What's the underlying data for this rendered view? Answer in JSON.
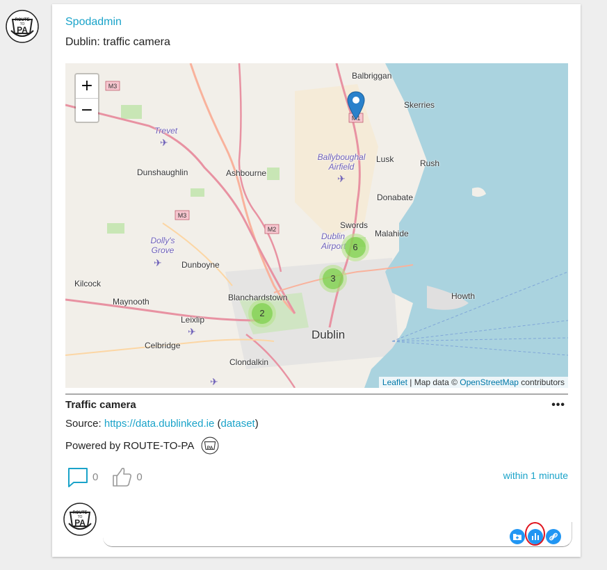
{
  "post": {
    "author": "Spodadmin",
    "text": "Dublin: traffic camera"
  },
  "avatar": {
    "logo_text_top": "ROUTE",
    "logo_text_mid": "TO",
    "logo_text_bottom": "PA"
  },
  "map": {
    "zoom_in": "+",
    "zoom_out": "−",
    "attribution": {
      "leaflet": "Leaflet",
      "sep": " | Map data © ",
      "osm": "OpenStreetMap",
      "contributors": " contributors"
    },
    "clusters": [
      "6",
      "3",
      "2"
    ],
    "places": [
      "Balbriggan",
      "Skerries",
      "Trevet",
      "Lusk",
      "Rush",
      "Ballyboughal Airfield",
      "Dunshaughlin",
      "Ashbourne",
      "Donabate",
      "Swords",
      "Malahide",
      "Dublin Airport",
      "Dolly's Grove",
      "Dunboyne",
      "Kilcock",
      "Maynooth",
      "Blanchardstown",
      "Howth",
      "Leixlip",
      "Dublin",
      "Celbridge",
      "Clondalkin"
    ],
    "road_labels": [
      "M3",
      "M3",
      "M2",
      "M1"
    ],
    "colors": {
      "sea": "#aad3df",
      "land": "#f2efe9",
      "motorway": "#e892a2",
      "trunk": "#f9b29c",
      "cluster_outer": "#b5e28c",
      "cluster_inner": "#6ecc39",
      "marker": "#2a81cb"
    }
  },
  "dataset": {
    "title": "Traffic camera",
    "more": "•••",
    "source_label": "Source: ",
    "source_link": "https://data.dublinked.ie",
    "open_paren": " (",
    "dataset_link": "dataset",
    "close_paren": ")",
    "powered_by": "Powered by ROUTE-TO-PA"
  },
  "actions": {
    "comment_count": "0",
    "like_count": "0",
    "time": "within 1 minute"
  },
  "comment_tools": {
    "icons": [
      "add-folder-icon",
      "chart-icon",
      "link-icon"
    ],
    "accent": "#2196f3",
    "highlight": "#e0141e"
  }
}
